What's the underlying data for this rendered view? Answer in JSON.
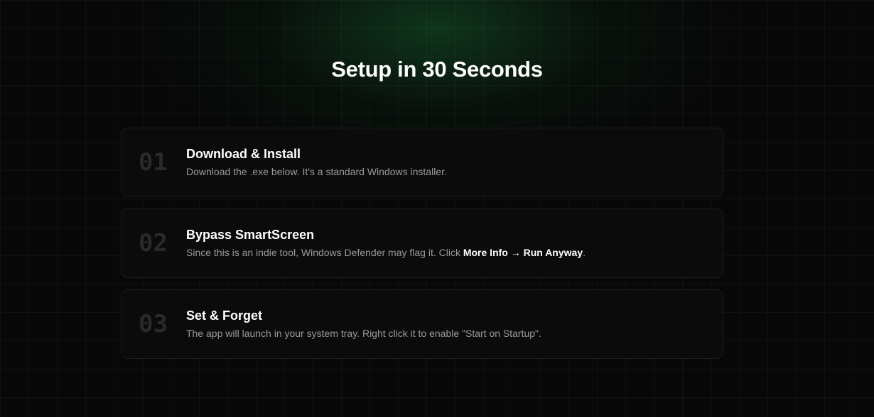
{
  "page": {
    "title": "Setup in 30 Seconds"
  },
  "colors": {
    "background": "#080808",
    "glow": "#145a2d",
    "card": "#0c0c0c",
    "card_border": "#1c1c1c",
    "step_number": "#2a2a2a",
    "description": "#9a9a9a"
  },
  "steps": [
    {
      "number": "01",
      "title": "Download & Install",
      "description": "Download the .exe below. It's a standard Windows installer."
    },
    {
      "number": "02",
      "title": "Bypass SmartScreen",
      "description_prefix": "Since this is an indie tool, Windows Defender may flag it. Click ",
      "description_emphasis": "More Info → Run Anyway",
      "description_suffix": "."
    },
    {
      "number": "03",
      "title": "Set & Forget",
      "description": "The app will launch in your system tray. Right click it to enable \"Start on Startup\"."
    }
  ]
}
